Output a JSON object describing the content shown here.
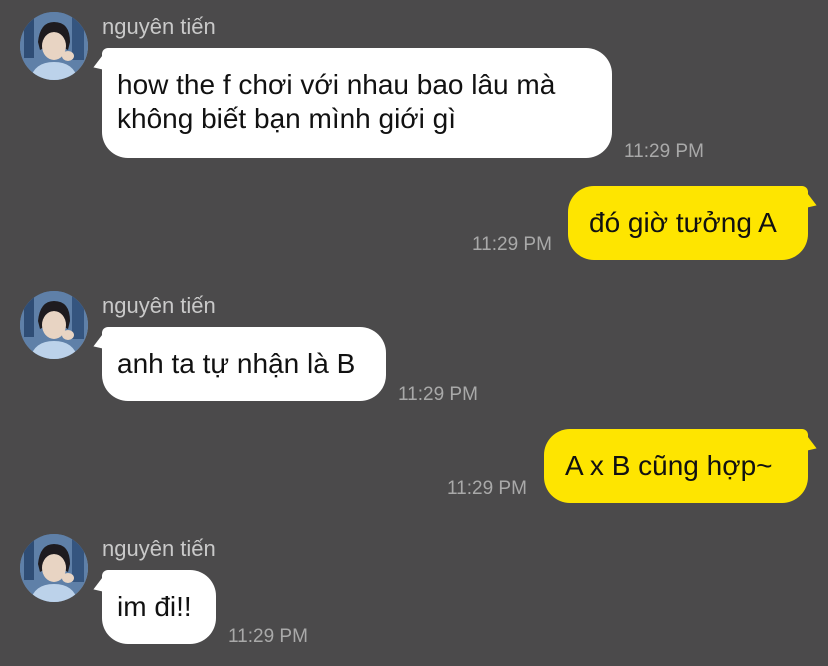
{
  "chat": {
    "contact_name": "nguyên tiến",
    "messages": [
      {
        "direction": "incoming",
        "sender": "nguyên tiến",
        "lines": [
          "how the f chơi với nhau bao lâu mà",
          "không biết bạn mình giới gì"
        ],
        "time": "11:29 PM"
      },
      {
        "direction": "outgoing",
        "text": "đó giờ tưởng A",
        "time": "11:29 PM"
      },
      {
        "direction": "incoming",
        "sender": "nguyên tiến",
        "text": "anh ta tự nhận là B",
        "time": "11:29 PM"
      },
      {
        "direction": "outgoing",
        "text": "A x B cũng hợp~",
        "time": "11:29 PM"
      },
      {
        "direction": "incoming",
        "sender": "nguyên tiến",
        "text": "im đi!!",
        "time": "11:29 PM"
      }
    ]
  },
  "colors": {
    "background": "#4b4a4b",
    "incoming_bubble": "#ffffff",
    "outgoing_bubble": "#fee500",
    "timestamp": "#a9a9a9",
    "sender_name": "#c9c9c9"
  },
  "icons": {
    "avatar": "profile-photo"
  }
}
